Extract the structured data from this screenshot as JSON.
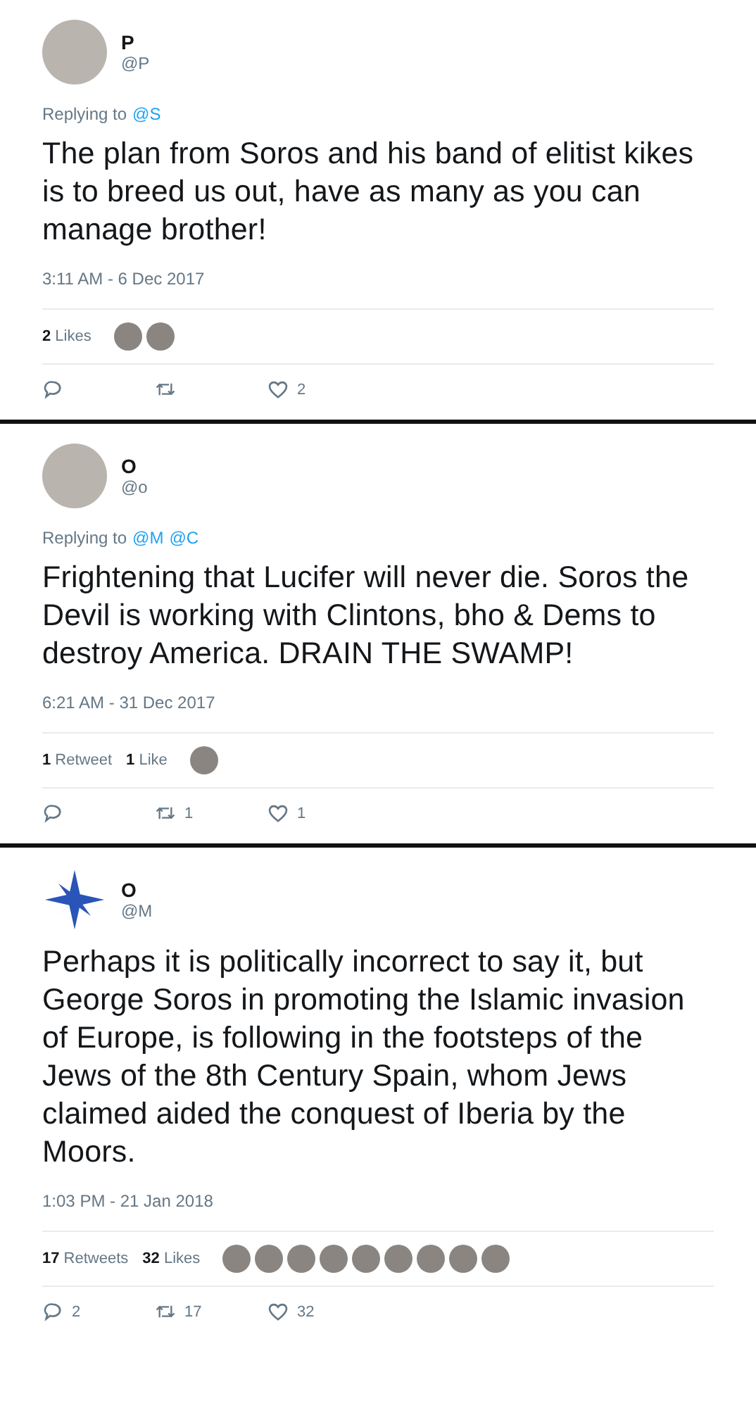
{
  "tweets": [
    {
      "avatar": {
        "kind": "photo"
      },
      "name": "P",
      "handle": "@P",
      "reply": {
        "label": "Replying to",
        "mentions": [
          "@S"
        ]
      },
      "text": "The plan from Soros and his band of elitist kikes is to breed us out, have as many as you can manage brother!",
      "time": "3:11 AM - 6 Dec 2017",
      "stats": [
        {
          "count": "2",
          "label": "Likes"
        }
      ],
      "likers": [
        {
          "kind": "photo"
        },
        {
          "kind": "photo"
        }
      ],
      "actions": [
        {
          "kind": "reply"
        },
        {
          "kind": "retweet"
        },
        {
          "kind": "like",
          "count": "2"
        }
      ]
    },
    {
      "avatar": {
        "kind": "photo"
      },
      "name": "O",
      "handle": "@o",
      "reply": {
        "label": "Replying to",
        "mentions": [
          "@M",
          "@C"
        ]
      },
      "text": "Frightening that Lucifer will never die.  Soros the Devil is working with Clintons, bho & Dems to destroy America. DRAIN THE SWAMP!",
      "time": "6:21 AM - 31 Dec 2017",
      "stats": [
        {
          "count": "1",
          "label": "Retweet"
        },
        {
          "count": "1",
          "label": "Like"
        }
      ],
      "likers": [
        {
          "kind": "photo"
        }
      ],
      "actions": [
        {
          "kind": "reply"
        },
        {
          "kind": "retweet",
          "count": "1"
        },
        {
          "kind": "like",
          "count": "1"
        }
      ]
    },
    {
      "avatar": {
        "kind": "cross"
      },
      "name": "O",
      "handle": "@M",
      "text": "Perhaps it is politically incorrect to say it, but George Soros in promoting the Islamic invasion of Europe, is following in the footsteps of the Jews of the 8th Century Spain, whom Jews claimed aided the conquest of Iberia by the Moors.",
      "time": "1:03 PM - 21 Jan 2018",
      "stats": [
        {
          "count": "17",
          "label": "Retweets"
        },
        {
          "count": "32",
          "label": "Likes"
        }
      ],
      "likers": [
        {
          "kind": "photo"
        },
        {
          "kind": "photo"
        },
        {
          "kind": "photo"
        },
        {
          "kind": "photo"
        },
        {
          "kind": "photo"
        },
        {
          "kind": "photo"
        },
        {
          "kind": "photo"
        },
        {
          "kind": "photo"
        },
        {
          "kind": "photo"
        }
      ],
      "actions": [
        {
          "kind": "reply",
          "count": "2"
        },
        {
          "kind": "retweet",
          "count": "17"
        },
        {
          "kind": "like",
          "count": "32"
        }
      ]
    }
  ]
}
